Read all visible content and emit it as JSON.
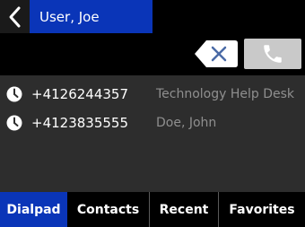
{
  "header": {
    "title": "User, Joe",
    "back_icon": "chevron-left-icon",
    "accent": "#0a35b8"
  },
  "dial": {
    "input_value": "",
    "backspace_icon": "backspace-icon",
    "call_icon": "phone-icon"
  },
  "recents": [
    {
      "number": "+4126244357",
      "name": "Technology Help Desk",
      "icon": "clock-icon"
    },
    {
      "number": "+4123835555",
      "name": "Doe, John",
      "icon": "clock-icon"
    }
  ],
  "tabs": [
    {
      "label": "Dialpad",
      "active": true
    },
    {
      "label": "Contacts",
      "active": false
    },
    {
      "label": "Recent",
      "active": false
    },
    {
      "label": "Favorites",
      "active": false
    }
  ]
}
